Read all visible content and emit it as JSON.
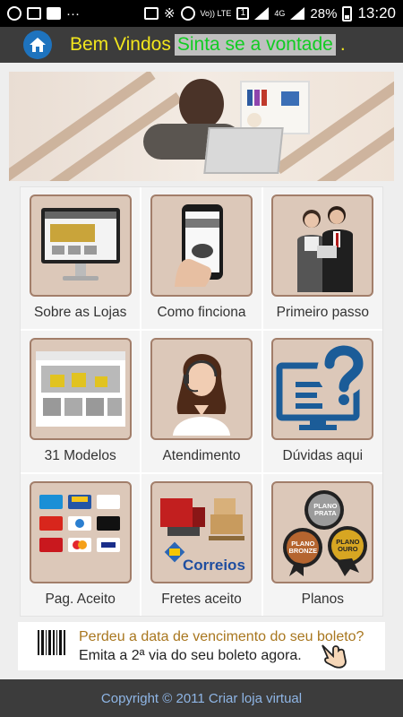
{
  "status_bar": {
    "battery": "28%",
    "time": "13:20",
    "volte": "Vo)) LTE",
    "sim": "1",
    "network": "4G"
  },
  "header": {
    "welcome": "Bem Vindos",
    "highlight": "Sinta se a vontade",
    "dot": "."
  },
  "tiles": [
    {
      "label": "Sobre as Lojas",
      "icon": "monitor-store-icon"
    },
    {
      "label": "Como finciona",
      "icon": "smartphone-hand-icon"
    },
    {
      "label": "Primeiro passo",
      "icon": "business-people-icon"
    },
    {
      "label": "31 Modelos",
      "icon": "store-template-icon"
    },
    {
      "label": "Atendimento",
      "icon": "support-agent-icon"
    },
    {
      "label": "Dúvidas aqui",
      "icon": "question-monitor-icon"
    },
    {
      "label": "Pag. Aceito",
      "icon": "payment-cards-icon"
    },
    {
      "label": "Fretes aceito",
      "icon": "shipping-correios-icon"
    },
    {
      "label": "Planos",
      "icon": "plan-medals-icon"
    }
  ],
  "thumb_text": {
    "correios": "Correios",
    "plano_prata": "PLANO PRATA",
    "plano_bronze": "PLANO BRONZE",
    "plano_ouro": "PLANO OURO"
  },
  "boleto": {
    "line1": "Perdeu a data de vencimento do seu boleto?",
    "line2": "Emita a 2ª via do seu boleto agora."
  },
  "footer": {
    "copyright": "Copyright © 2011 Criar loja virtual"
  },
  "colors": {
    "header_bg": "#3c3c3c",
    "welcome": "#f2e61d",
    "highlight": "#11cc22",
    "home_button": "#1e73be",
    "footer_text": "#8fb6e6",
    "thumb_bg": "#dcc8b9",
    "boleto_line1": "#a8761e"
  }
}
